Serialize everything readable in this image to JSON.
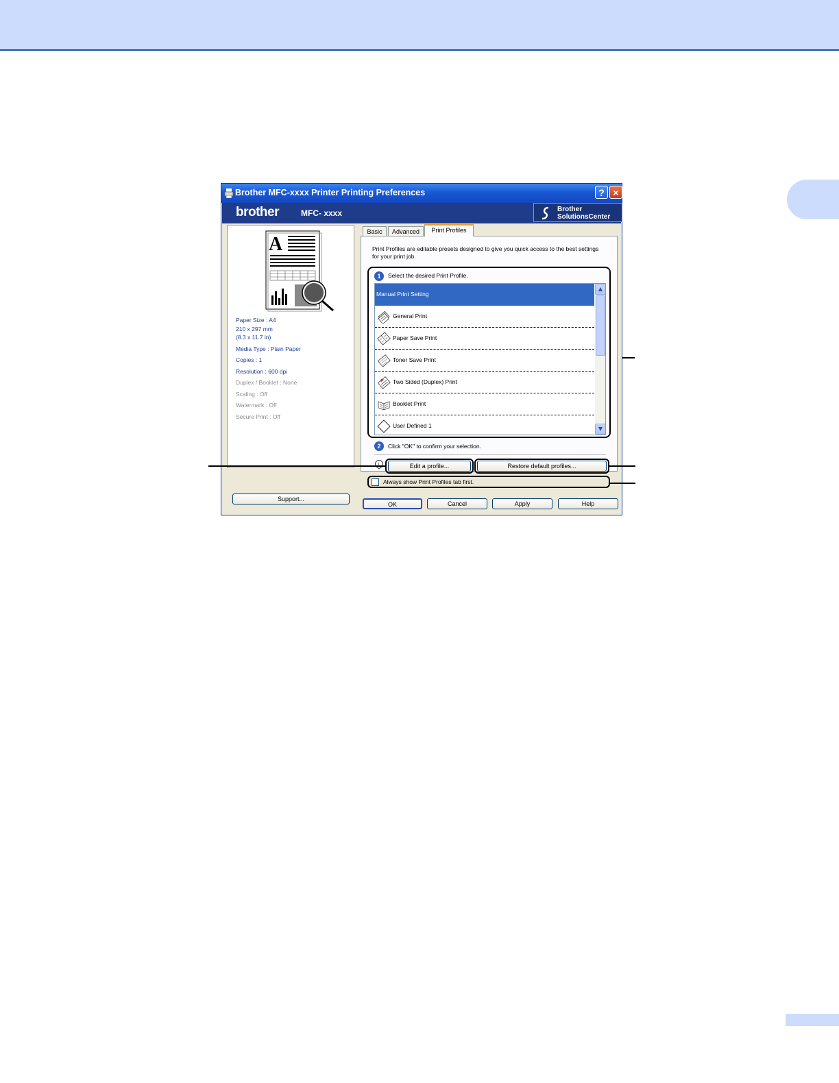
{
  "window": {
    "title": "Brother MFC-xxxx Printer Printing Preferences",
    "help_glyph": "?",
    "close_glyph": "×"
  },
  "brand": {
    "logo": "brother",
    "model": "MFC- xxxx",
    "solutions_line1": "Brother",
    "solutions_line2": "SolutionsCenter"
  },
  "preview": {
    "letter": "A"
  },
  "settings_summary": [
    {
      "text": "Paper Size : A4",
      "enabled": true
    },
    {
      "text": "210 x 297 mm",
      "enabled": true
    },
    {
      "text": "(8.3 x 11.7 in)",
      "enabled": true
    },
    {
      "text": "Media Type : Plain Paper",
      "enabled": true
    },
    {
      "text": "Copies : 1",
      "enabled": true
    },
    {
      "text": "Resolution : 600 dpi",
      "enabled": true
    },
    {
      "text": "Duplex / Booklet : None",
      "enabled": false
    },
    {
      "text": "Scaling : Off",
      "enabled": false
    },
    {
      "text": "Watermark : Off",
      "enabled": false
    },
    {
      "text": "Secure Print : Off",
      "enabled": false
    }
  ],
  "support_button": "Support...",
  "tabs": [
    {
      "label": "Basic",
      "active": false
    },
    {
      "label": "Advanced",
      "active": false
    },
    {
      "label": "Print Profiles",
      "active": true
    }
  ],
  "profiles_tab": {
    "description": "Print Profiles are editable presets designed to give you quick access to the best settings for your print job.",
    "step1_number": "1",
    "step1_label": "Select the desired Print Profile.",
    "profiles": [
      {
        "label": "Manual Print Setting",
        "selected": true,
        "icon": "none"
      },
      {
        "label": "General Print",
        "selected": false,
        "icon": "page-stack-icon"
      },
      {
        "label": "Paper Save Print",
        "selected": false,
        "icon": "paper-save-icon"
      },
      {
        "label": "Toner Save Print",
        "selected": false,
        "icon": "toner-save-icon"
      },
      {
        "label": "Two Sided (Duplex) Print",
        "selected": false,
        "icon": "duplex-icon"
      },
      {
        "label": "Booklet Print",
        "selected": false,
        "icon": "booklet-icon"
      },
      {
        "label": "User Defined 1",
        "selected": false,
        "icon": "diamond-icon"
      }
    ],
    "step2_number": "2",
    "step2_label": "Click \"OK\" to confirm your selection.",
    "edit_button": "Edit a profile...",
    "restore_button": "Restore default profiles...",
    "always_show_label": "Always show Print Profiles tab first.",
    "always_show_checked": false
  },
  "footer_buttons": {
    "ok": "OK",
    "cancel": "Cancel",
    "apply": "Apply",
    "help": "Help"
  },
  "colors": {
    "page_band": "#ccdcfd",
    "title_bar": "#1a58d4",
    "brand_bar": "#1e3c8a",
    "selection": "#3168c4",
    "settings_text": "#1b3f9a"
  }
}
